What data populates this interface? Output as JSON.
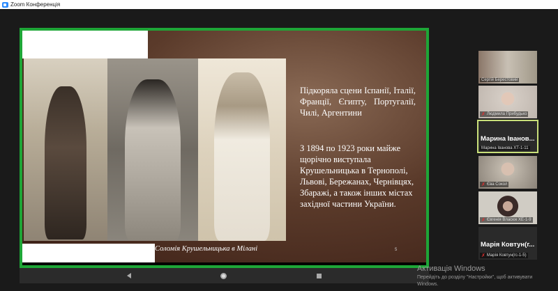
{
  "window": {
    "title": "Zoom Конференція",
    "icon": "zoom-icon"
  },
  "slide": {
    "text1": "Підкоряла сцени Іспанії, Італії, Франції, Єгипту, Португалії, Чилі, Аргентини",
    "text2": "З 1894 по 1923 роки майже щорічно виступала Крушельницька в Тернополі, Львові, Бережанах, Чернівцях, Збаражі, а також інших містах західної частини України.",
    "caption": "Соломія Крушельницька в Мілані",
    "page": "5",
    "accent": "#1ea637"
  },
  "participants": [
    {
      "name": "Сергій Берестовий",
      "video": true,
      "muted": false
    },
    {
      "name": "Людмила Прибудько",
      "video": true,
      "muted": true
    },
    {
      "name": "Марина Іванова ХТ-1-11",
      "display": "Марина Іванов...",
      "video": false,
      "muted": false,
      "active": true
    },
    {
      "name": "Єва Сокол",
      "video": true,
      "muted": true
    },
    {
      "name": "Євгенія Власюк ХЕ-1-9",
      "video": true,
      "muted": true
    },
    {
      "name": "Марія Ковтун(гс-1-5)",
      "display": "Марія Ковтун(г...",
      "video": false,
      "muted": true
    }
  ],
  "watermark": {
    "title": "Активація Windows",
    "text": "Перейдіть до розділу \"Настройки\", щоб активувати Windows."
  }
}
